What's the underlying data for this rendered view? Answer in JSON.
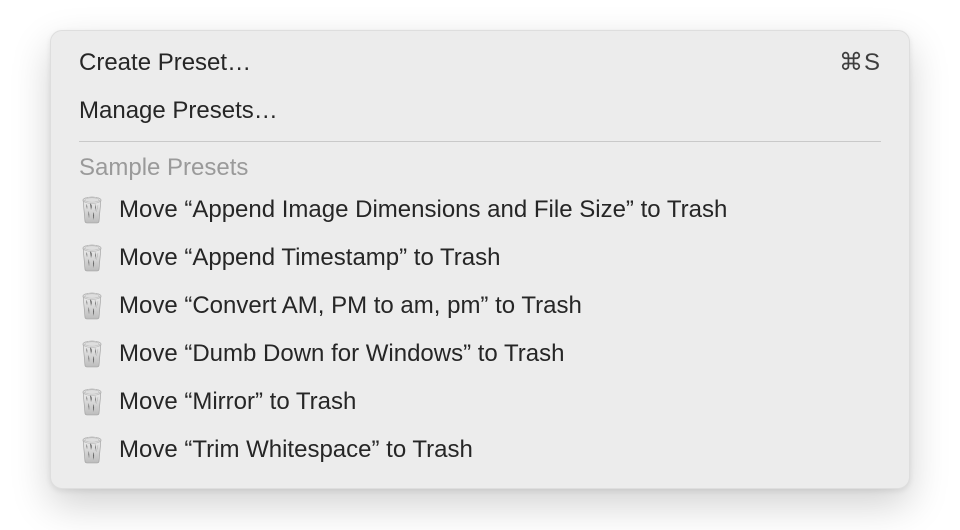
{
  "menu": {
    "create_preset": "Create Preset…",
    "create_preset_shortcut": "⌘S",
    "manage_presets": "Manage Presets…",
    "section_header": "Sample Presets",
    "presets": [
      {
        "label": "Move “Append Image Dimensions and File Size” to Trash"
      },
      {
        "label": "Move “Append Timestamp” to Trash"
      },
      {
        "label": "Move “Convert AM, PM to am, pm” to Trash"
      },
      {
        "label": "Move “Dumb Down for Windows” to Trash"
      },
      {
        "label": "Move “Mirror” to Trash"
      },
      {
        "label": "Move “Trim Whitespace” to Trash"
      }
    ]
  }
}
